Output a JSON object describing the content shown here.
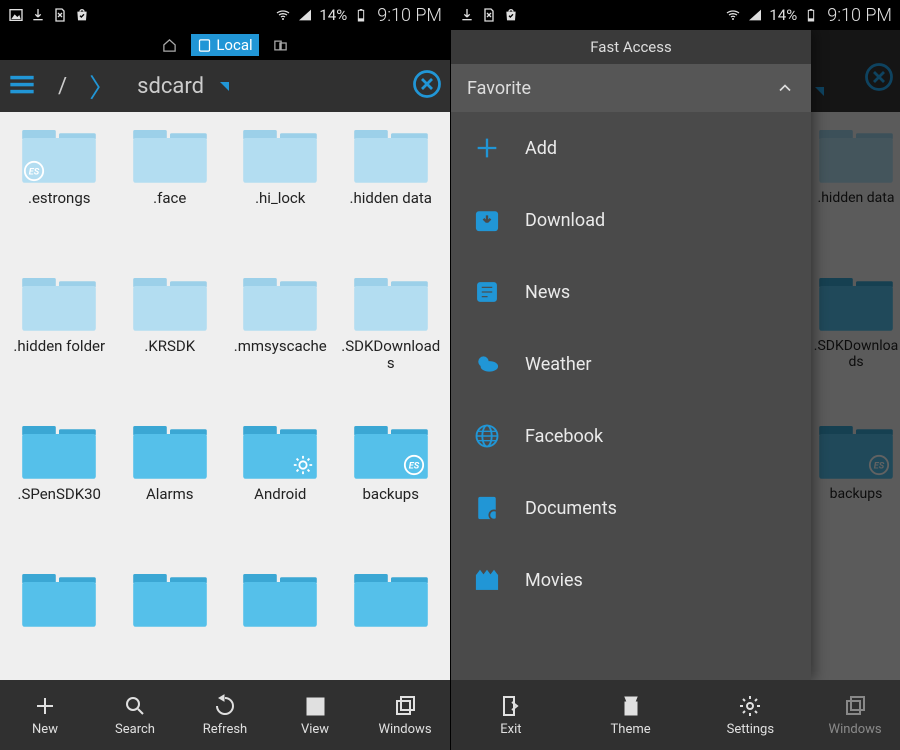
{
  "status": {
    "battery": "14%",
    "time": "9:10 PM"
  },
  "tabs": {
    "local": "Local"
  },
  "path": {
    "root": "/",
    "current": "sdcard"
  },
  "folders": [
    ".estrongs",
    ".face",
    ".hi_lock",
    ".hidden data",
    ".hidden folder",
    ".KRSDK",
    ".mmsyscache",
    ".SDKDownloads",
    ".SPenSDK30",
    "Alarms",
    "Android",
    "backups",
    "",
    "",
    "",
    ""
  ],
  "folder_shade": [
    "l",
    "l",
    "l",
    "l",
    "l",
    "l",
    "l",
    "l",
    "d",
    "d",
    "d",
    "d",
    "d",
    "d",
    "d",
    "d"
  ],
  "bottom": {
    "new": "New",
    "search": "Search",
    "refresh": "Refresh",
    "view": "View",
    "windows": "Windows"
  },
  "panel": {
    "title": "Fast Access",
    "section": "Favorite",
    "items": [
      {
        "icon": "plus",
        "label": "Add"
      },
      {
        "icon": "download",
        "label": "Download"
      },
      {
        "icon": "news",
        "label": "News"
      },
      {
        "icon": "weather",
        "label": "Weather"
      },
      {
        "icon": "globe",
        "label": "Facebook"
      },
      {
        "icon": "docs",
        "label": "Documents"
      },
      {
        "icon": "movie",
        "label": "Movies"
      }
    ]
  },
  "right_bottom": {
    "exit": "Exit",
    "theme": "Theme",
    "settings": "Settings",
    "windows": "Windows"
  },
  "right_folders": [
    ".hidden data",
    ".SDKDownloads",
    "backups"
  ]
}
